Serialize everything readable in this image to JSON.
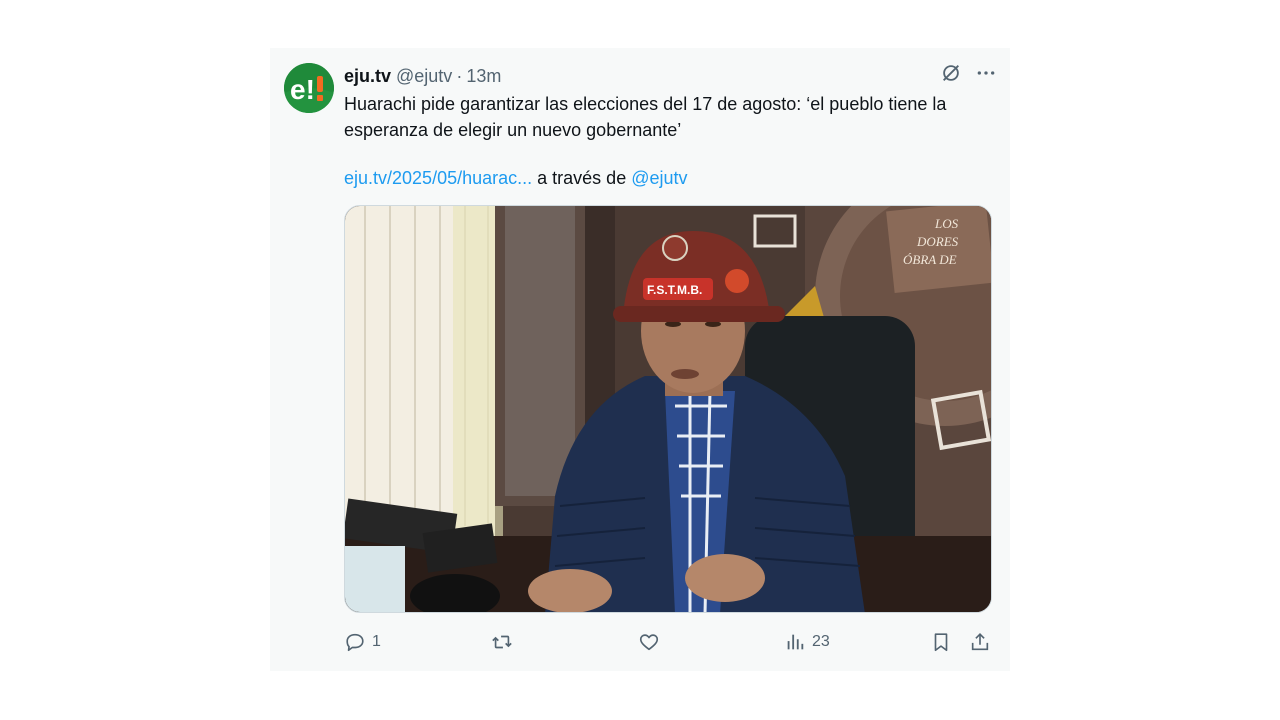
{
  "tweet": {
    "display_name": "eju.tv",
    "handle": "@ejutv",
    "separator": "·",
    "time": "13m",
    "avatar_text": "e!",
    "text": "Huarachi pide garantizar las elecciones del 17 de agosto: ‘el pueblo tiene la esperanza de elegir un nuevo gobernante’",
    "link_text": "eju.tv/2025/05/huarac...",
    "via_text": "a través de",
    "via_handle": "@ejutv",
    "helmet_text": "F.S.T.M.B.",
    "wall_text_1": "LOS",
    "wall_text_2": "DORES",
    "wall_text_3": "ÓBRA DE"
  },
  "actions": {
    "reply_count": "1",
    "retweet_count": "",
    "like_count": "",
    "views_count": "23"
  },
  "colors": {
    "accent": "#1d9bf0",
    "text": "#0f1419",
    "muted": "#536471",
    "card_bg": "#f7f9f9",
    "brand_green": "#1f8a3a",
    "brand_orange": "#f26b21"
  },
  "icons": {
    "grok": "grok-icon",
    "more": "more-icon",
    "reply": "reply-icon",
    "retweet": "retweet-icon",
    "like": "heart-icon",
    "views": "views-icon",
    "bookmark": "bookmark-icon",
    "share": "share-icon"
  }
}
